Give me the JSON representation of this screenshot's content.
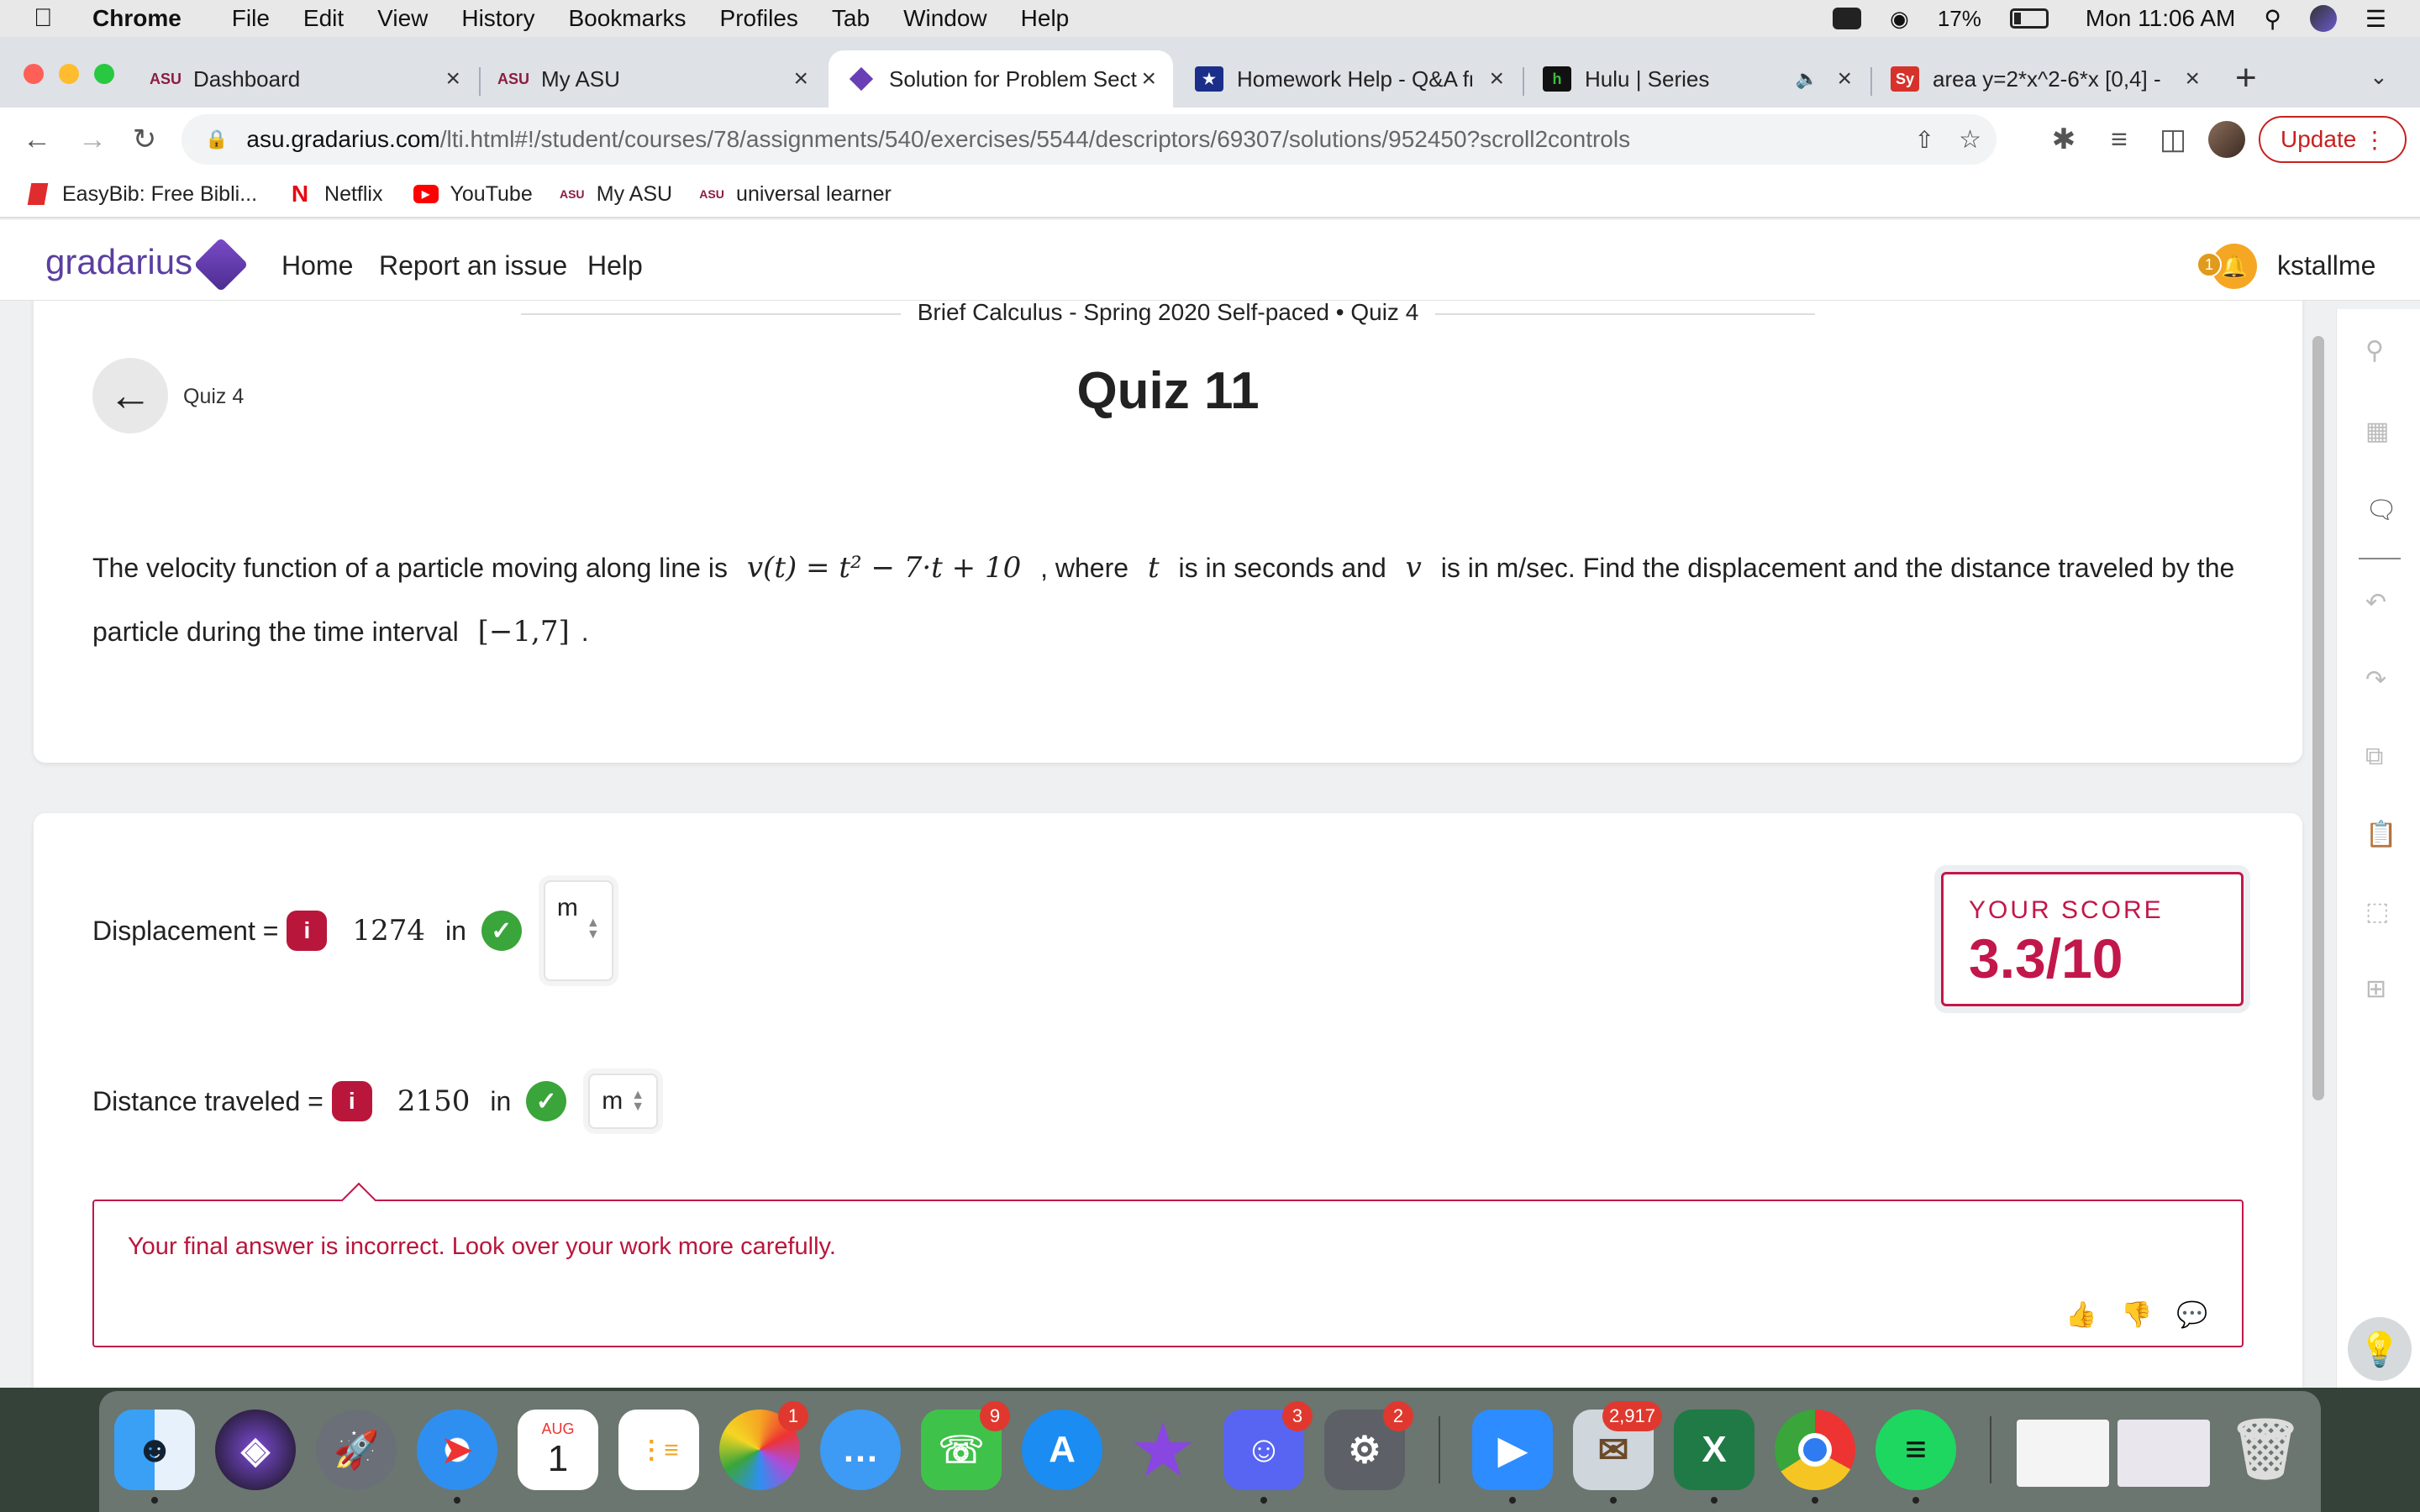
{
  "menubar": {
    "app": "Chrome",
    "items": [
      "File",
      "Edit",
      "View",
      "History",
      "Bookmarks",
      "Profiles",
      "Tab",
      "Window",
      "Help"
    ],
    "battery": "17%",
    "clock": "Mon 11:06 AM"
  },
  "tabs": [
    {
      "label": "Dashboard",
      "favicon": "ASU"
    },
    {
      "label": "My ASU",
      "favicon": "ASU"
    },
    {
      "label": "Solution for Problem Sect",
      "favicon": "gradarius"
    },
    {
      "label": "Homework Help - Q&A fr",
      "favicon": "star"
    },
    {
      "label": "Hulu | Series",
      "favicon": "h"
    },
    {
      "label": "area y=2*x^2-6*x [0,4] -",
      "favicon": "Sy"
    }
  ],
  "address": {
    "host": "asu.gradarius.com",
    "path": "/lti.html#!/student/courses/78/assignments/540/exercises/5544/descriptors/69307/solutions/952450?scroll2controls"
  },
  "toolbar": {
    "update_label": "Update"
  },
  "bookmarks": [
    "EasyBib: Free Bibli...",
    "Netflix",
    "YouTube",
    "My ASU",
    "universal learner"
  ],
  "gradarius": {
    "logo": "gradarius",
    "nav": [
      "Home",
      "Report an issue",
      "Help"
    ],
    "notifications": "1",
    "username": "kstallme"
  },
  "question": {
    "breadcrumb": "Brief Calculus - Spring 2020 Self-paced • Quiz 4",
    "back_label": "Quiz 4",
    "title": "Quiz 11",
    "text_1": "The velocity function of a particle moving along line is",
    "formula": "v(t) = t² − 7·t + 10",
    "text_2": ", where",
    "var_t": "t",
    "text_3": "is in seconds and",
    "var_v": "v",
    "text_4": "is in m/sec. Find the displacement and the distance traveled by the particle during the time interval",
    "interval": "[−1,7]",
    "text_5": "."
  },
  "answers": {
    "displacement_label": "Displacement =",
    "displacement_value": "1274",
    "distance_label": "Distance traveled =",
    "distance_value": "2150",
    "in_word": "in",
    "unit": "m"
  },
  "score": {
    "label": "YOUR SCORE",
    "value": "3.3/10"
  },
  "feedback": "Your final answer is incorrect. Look over your work more carefully.",
  "dock": {
    "calendar_month": "AUG",
    "calendar_day": "1",
    "badges": {
      "photos": "1",
      "facetime": "9",
      "discord": "3",
      "settings": "2",
      "mail": "2,917"
    }
  },
  "colors": {
    "accent": "#c2174a",
    "brand": "#5a3fa0",
    "success": "#3aa53a"
  }
}
